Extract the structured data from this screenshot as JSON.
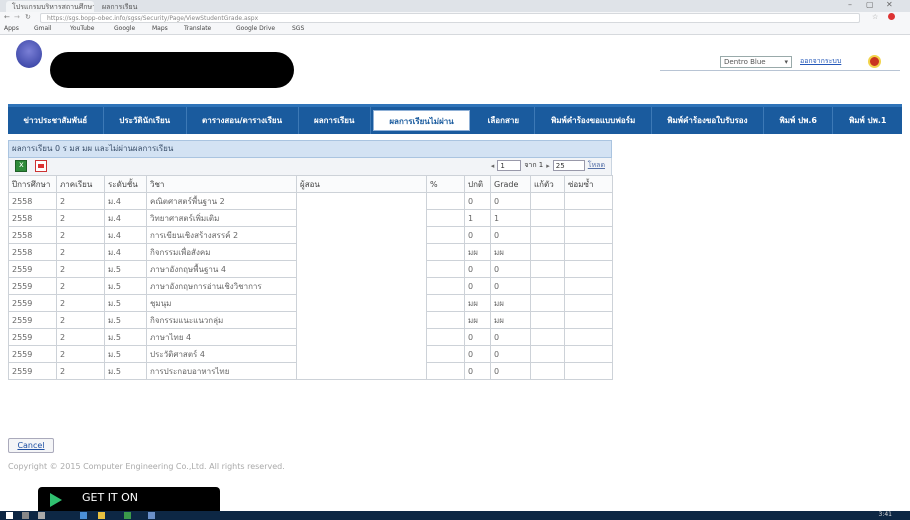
{
  "browser": {
    "tabs": [
      "โปรแกรมบริหารสถานศึกษา",
      "ผลการเรียน"
    ],
    "address": "https://sgs.bopp-obec.info/sgss/Security/Page/ViewStudentGrade.aspx",
    "bookmarks": [
      "Apps",
      "Gmail",
      "YouTube",
      "Google",
      "Maps",
      "Translate",
      "Google Drive",
      "SGS"
    ]
  },
  "header": {
    "theme_value": "Dentro Blue",
    "logout_label": "ออกจากระบบ"
  },
  "nav": {
    "items": [
      {
        "label": "ข่าวประชาสัมพันธ์",
        "active": false
      },
      {
        "label": "ประวัตินักเรียน",
        "active": false
      },
      {
        "label": "ตารางสอน/ตารางเรียน",
        "active": false
      },
      {
        "label": "ผลการเรียน",
        "active": false
      },
      {
        "label": "ผลการเรียนไม่ผ่าน",
        "active": true
      },
      {
        "label": "เลือกสาย",
        "active": false
      },
      {
        "label": "พิมพ์คำร้องขอแบบฟอร์ม",
        "active": false
      },
      {
        "label": "พิมพ์คำร้องขอใบรับรอง",
        "active": false
      },
      {
        "label": "พิมพ์ ปพ.6",
        "active": false
      },
      {
        "label": "พิมพ์ ปพ.1",
        "active": false
      }
    ]
  },
  "panel": {
    "title": "ผลการเรียน 0 ร มส มผ และไม่ผ่านผลการเรียน"
  },
  "pager": {
    "page_value": "1",
    "page_of": "จาก 1",
    "page_size": "25",
    "refresh_label": "โหลด"
  },
  "table": {
    "headers": [
      "ปีการศึกษา",
      "ภาคเรียน",
      "ระดับชั้น",
      "วิชา",
      "ผู้สอน",
      "%",
      "ปกติ",
      "Grade",
      "แก้ตัว",
      "ซ่อมซ้ำ"
    ],
    "rows": [
      [
        "2558",
        "2",
        "ม.4",
        "คณิตศาสตร์พื้นฐาน 2",
        "",
        "",
        "0",
        "0",
        "",
        ""
      ],
      [
        "2558",
        "2",
        "ม.4",
        "วิทยาศาสตร์เพิ่มเติม",
        "",
        "",
        "1",
        "1",
        "",
        ""
      ],
      [
        "2558",
        "2",
        "ม.4",
        "การเขียนเชิงสร้างสรรค์ 2",
        "",
        "",
        "0",
        "0",
        "",
        ""
      ],
      [
        "2558",
        "2",
        "ม.4",
        "กิจกรรมเพื่อสังคม",
        "",
        "",
        "มผ",
        "มผ",
        "",
        ""
      ],
      [
        "2559",
        "2",
        "ม.5",
        "ภาษาอังกฤษพื้นฐาน 4",
        "",
        "",
        "0",
        "0",
        "",
        ""
      ],
      [
        "2559",
        "2",
        "ม.5",
        "ภาษาอังกฤษการอ่านเชิงวิชาการ",
        "",
        "",
        "0",
        "0",
        "",
        ""
      ],
      [
        "2559",
        "2",
        "ม.5",
        "ชุมนุม",
        "",
        "",
        "มผ",
        "มผ",
        "",
        ""
      ],
      [
        "2559",
        "2",
        "ม.5",
        "กิจกรรมแนะแนวกลุ่ม",
        "",
        "",
        "มผ",
        "มผ",
        "",
        ""
      ],
      [
        "2559",
        "2",
        "ม.5",
        "ภาษาไทย 4",
        "",
        "",
        "0",
        "0",
        "",
        ""
      ],
      [
        "2559",
        "2",
        "ม.5",
        "ประวัติศาสตร์ 4",
        "",
        "",
        "0",
        "0",
        "",
        ""
      ],
      [
        "2559",
        "2",
        "ม.5",
        "การประกอบอาหารไทย",
        "",
        "",
        "0",
        "0",
        "",
        ""
      ]
    ]
  },
  "footer": {
    "cancel_label": "Cancel",
    "copyright": "Copyright © 2015 Computer Engineering Co.,Ltd. All rights reserved."
  },
  "taskbar": {
    "gplay_label": "GET IT ON",
    "clock": "3:41"
  },
  "colors": {
    "nav_bg": "#1a5b9e",
    "panel_title_bg": "#d3e2f3"
  }
}
